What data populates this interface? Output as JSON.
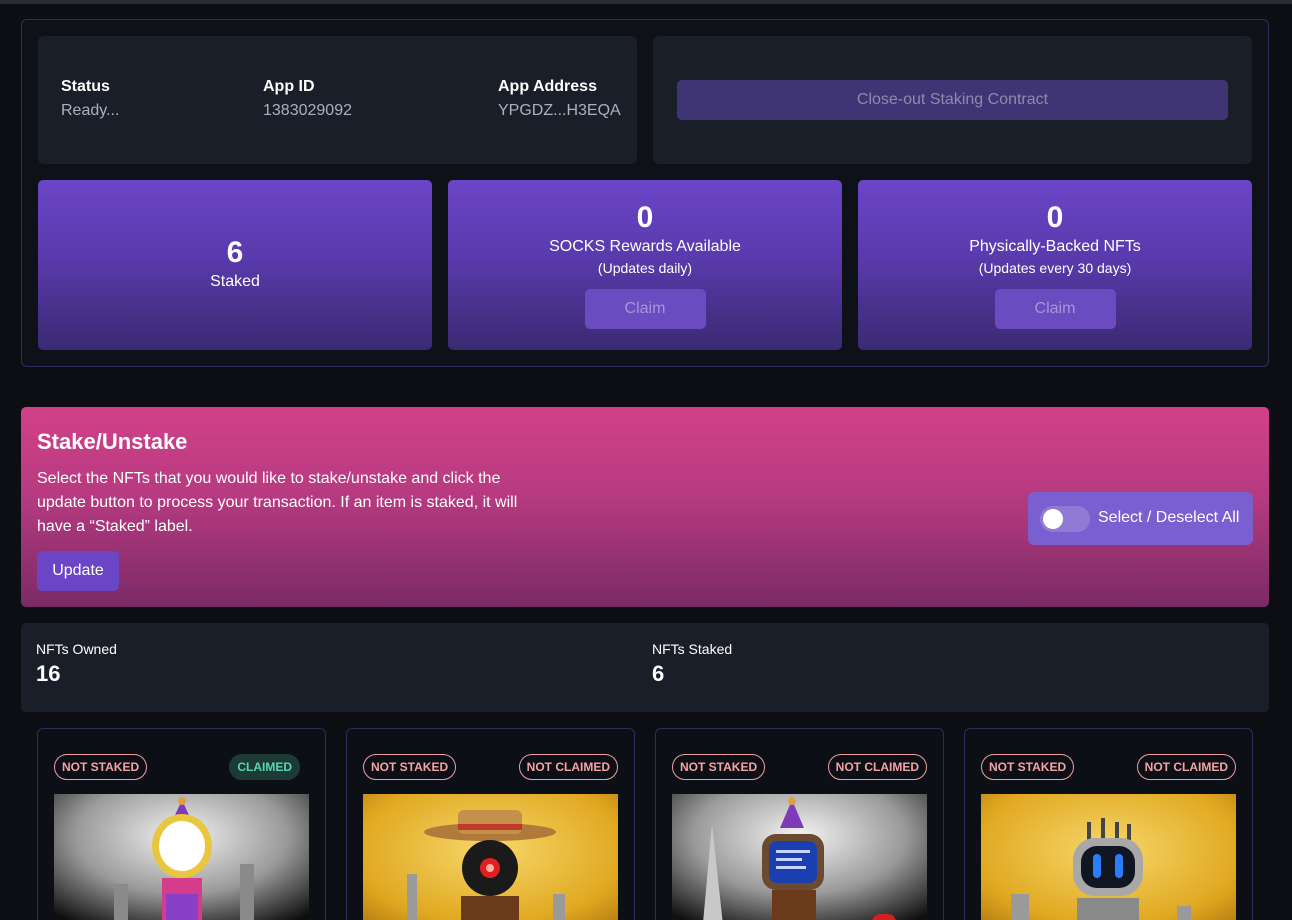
{
  "info": {
    "status_label": "Status",
    "status_value": "Ready...",
    "appid_label": "App ID",
    "appid_value": "1383029092",
    "address_label": "App Address",
    "address_value": "YPGDZ...H3EQA"
  },
  "actions": {
    "closeout_label": "Close-out Staking Contract"
  },
  "stats": [
    {
      "value": "6",
      "label": "Staked"
    },
    {
      "value": "0",
      "label": "SOCKS Rewards Available",
      "sub": "(Updates daily)",
      "button": "Claim"
    },
    {
      "value": "0",
      "label": "Physically-Backed NFTs",
      "sub": "(Updates every 30 days)",
      "button": "Claim"
    }
  ],
  "stake": {
    "title": "Stake/Unstake",
    "description": "Select the NFTs that you would like to stake/unstake and click the update button to process your transaction. If an item is staked, it will have a “Staked” label.",
    "update_label": "Update",
    "select_all_label": "Select / Deselect All"
  },
  "counts": {
    "owned_label": "NFTs Owned",
    "owned_value": "16",
    "staked_label": "NFTs Staked",
    "staked_value": "6"
  },
  "nfts": [
    {
      "stake_badge": "NOT STAKED",
      "claim_badge": "CLAIMED"
    },
    {
      "stake_badge": "NOT STAKED",
      "claim_badge": "NOT CLAIMED"
    },
    {
      "stake_badge": "NOT STAKED",
      "claim_badge": "NOT CLAIMED"
    },
    {
      "stake_badge": "NOT STAKED",
      "claim_badge": "NOT CLAIMED"
    }
  ],
  "colors": {
    "accent": "#6a45c6",
    "stake_panel": "#d2418a",
    "badge_not": "#f4a3a3",
    "badge_claimed": "#5ad6b2"
  }
}
